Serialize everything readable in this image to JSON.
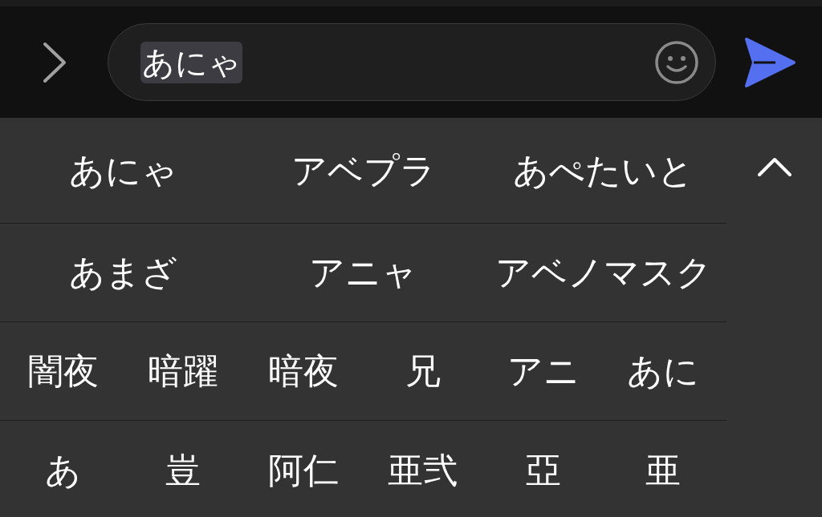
{
  "input": {
    "value": "あにゃ",
    "composing": true
  },
  "candidate_rows": [
    [
      "あにゃ",
      "アベプラ",
      "あぺたいと"
    ],
    [
      "あまざ",
      "アニャ",
      "アベノマスク"
    ],
    [
      "闇夜",
      "暗躍",
      "暗夜",
      "兄",
      "アニ",
      "あに"
    ],
    [
      "あ",
      "豈",
      "阿仁",
      "亜弐",
      "亞",
      "亜"
    ]
  ]
}
